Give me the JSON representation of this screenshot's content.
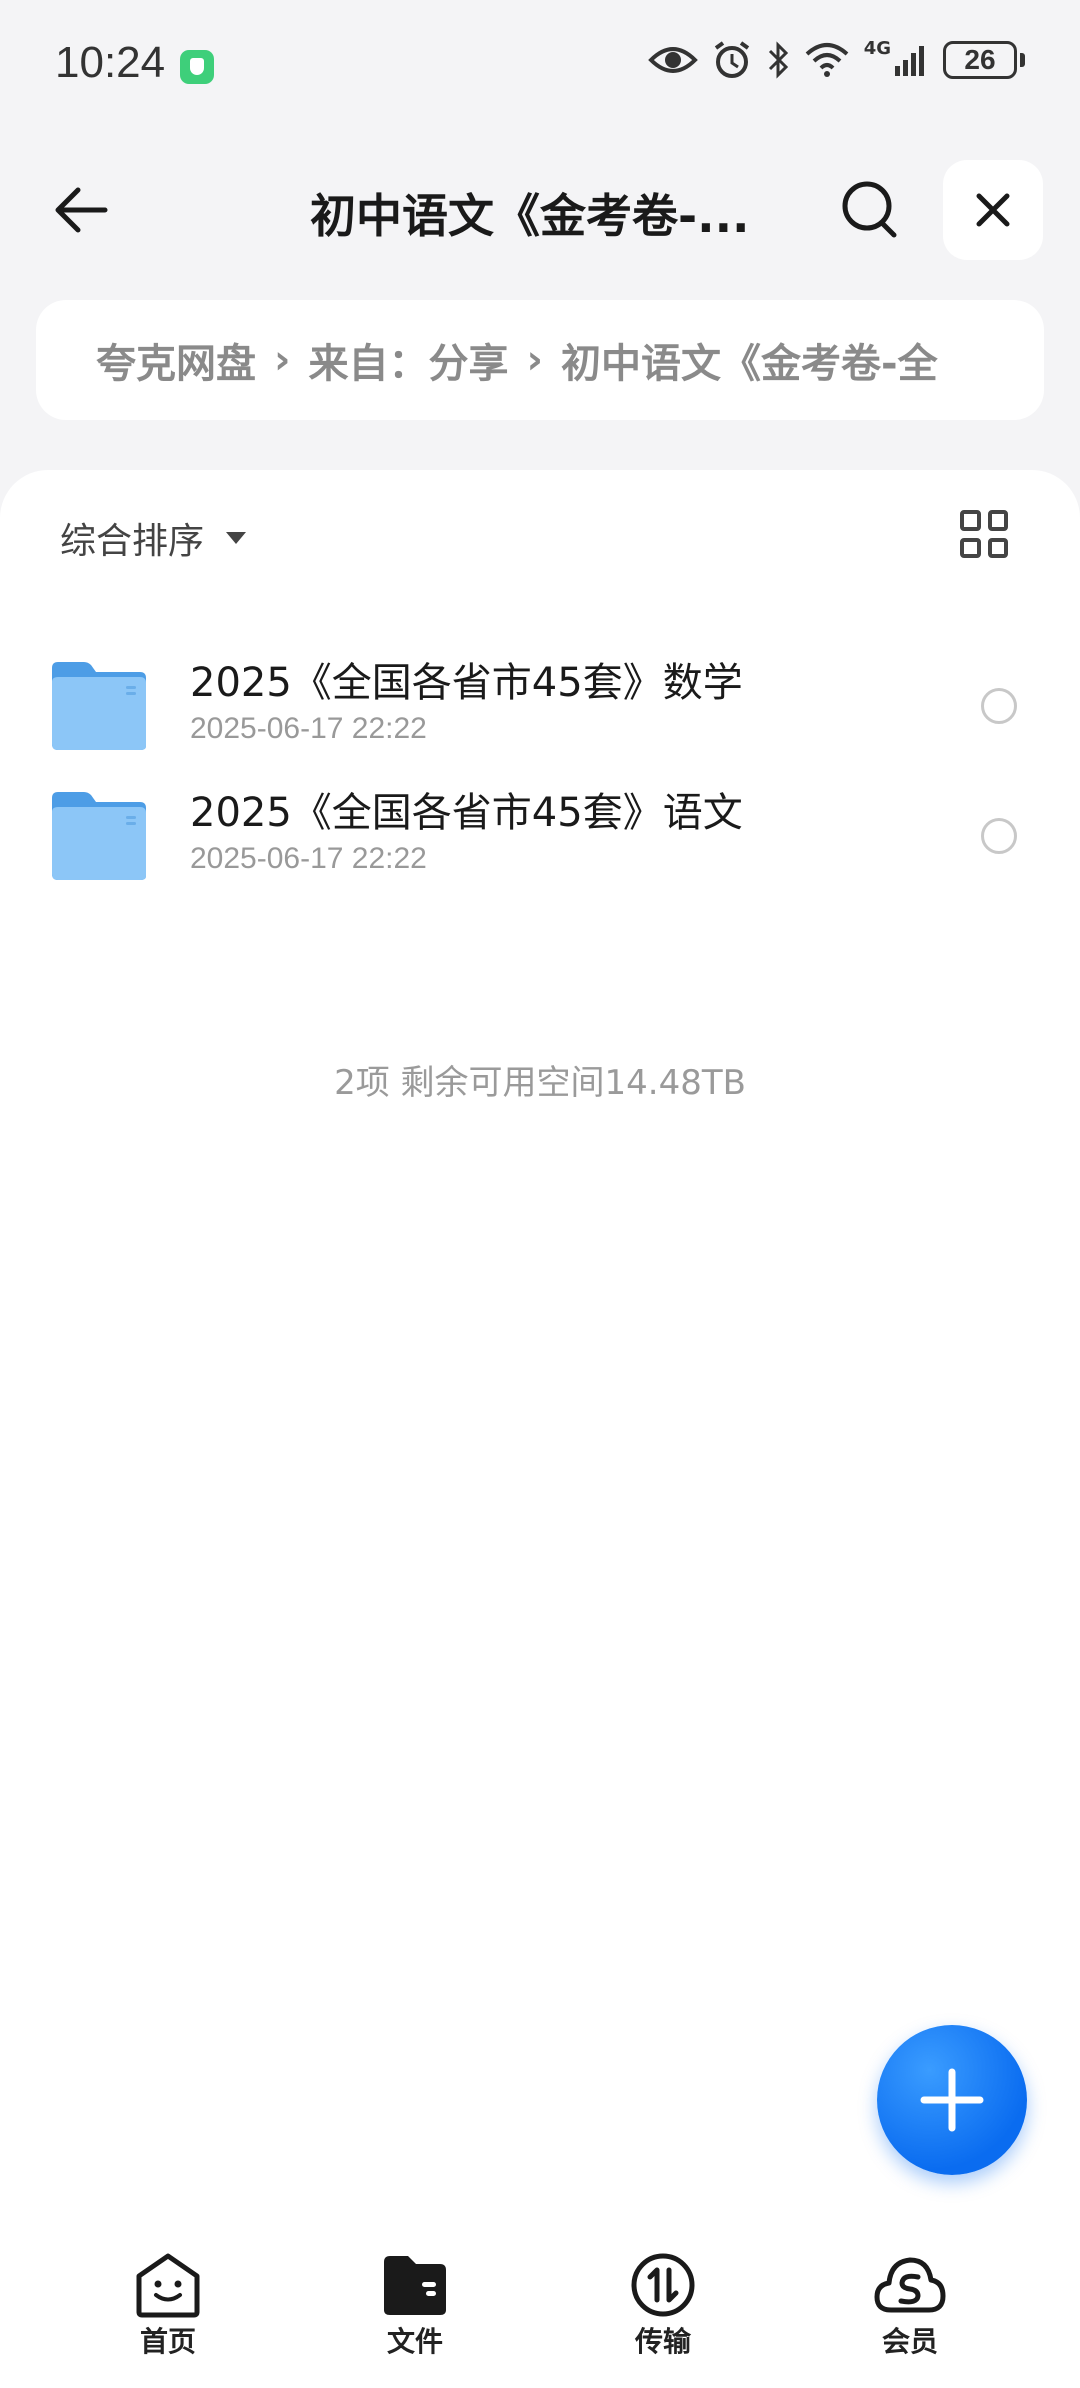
{
  "status_bar": {
    "time": "10:24",
    "network_label": "4G",
    "battery": "26"
  },
  "header": {
    "title": "初中语文《金考卷-...",
    "back_icon": "arrow-left-icon",
    "search_icon": "search-icon",
    "close_icon": "close-icon"
  },
  "breadcrumb": {
    "items": [
      "夸克网盘",
      "来自：分享",
      "初中语文《金考卷-全"
    ]
  },
  "toolbar": {
    "sort_label": "综合排序",
    "view_icon": "grid-view-icon"
  },
  "files": [
    {
      "name": "2025《全国各省市45套》数学",
      "date": "2025-06-17 22:22",
      "icon": "folder-icon"
    },
    {
      "name": "2025《全国各省市45套》语文",
      "date": "2025-06-17 22:22",
      "icon": "folder-icon"
    }
  ],
  "summary": "2项 剩余可用空间14.48TB",
  "fab_icon": "plus-icon",
  "tabs": [
    {
      "label": "首页",
      "icon": "home-face-icon"
    },
    {
      "label": "文件",
      "icon": "folder-file-icon"
    },
    {
      "label": "传输",
      "icon": "transfer-icon"
    },
    {
      "label": "会员",
      "icon": "cloud-member-icon"
    }
  ],
  "colors": {
    "accent": "#0a6cf0",
    "folder": "#5aa9ef",
    "background": "#f4f4f6"
  }
}
